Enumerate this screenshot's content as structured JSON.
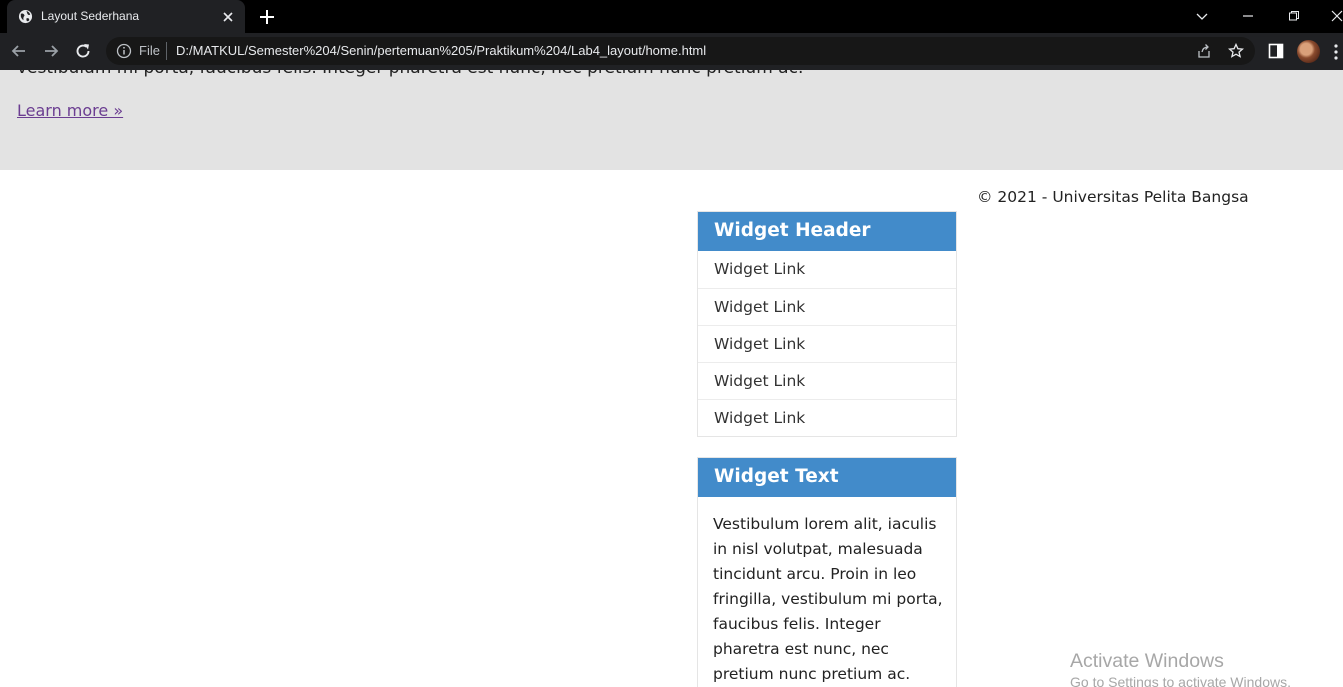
{
  "browser": {
    "tab_title": "Layout Sederhana",
    "omnibox": {
      "scheme_label": "File",
      "url": "D:/MATKUL/Semester%204/Senin/pertemuan%205/Praktikum%204/Lab4_layout/home.html"
    },
    "icons": [
      "globe-icon",
      "close-icon",
      "plus-icon",
      "chevron-down-icon",
      "minimize-icon",
      "restore-icon",
      "window-close-icon",
      "back-arrow-icon",
      "forward-arrow-icon",
      "reload-icon",
      "info-icon",
      "share-icon",
      "star-icon",
      "side-panel-icon",
      "avatar",
      "kebab-menu-icon"
    ],
    "colors": {
      "tab_strip": "#000000",
      "toolbar": "#202124",
      "omnibox": "#171717"
    }
  },
  "page": {
    "hero": {
      "text": "vestibulum mi porta, faucibus felis. Integer pharetra est nunc, nec pretium nunc pretium ac.",
      "link": "Learn more »"
    },
    "footer": "© 2021 - Universitas Pelita Bangsa",
    "widget_links": {
      "header": "Widget Header",
      "links": [
        "Widget Link",
        "Widget Link",
        "Widget Link",
        "Widget Link",
        "Widget Link"
      ]
    },
    "widget_text": {
      "header": "Widget Text",
      "body": "Vestibulum lorem alit, iaculis in nisl volutpat, malesuada tincidunt arcu. Proin in leo fringilla, vestibulum mi porta, faucibus felis. Integer pharetra est nunc, nec pretium nunc pretium ac."
    },
    "colors": {
      "hero_bg": "#e3e3e3",
      "widget_header": "#428bca",
      "link": "#6b3d91"
    }
  },
  "overlay": {
    "activate_title": "Activate Windows",
    "activate_subtitle": "Go to Settings to activate Windows."
  }
}
